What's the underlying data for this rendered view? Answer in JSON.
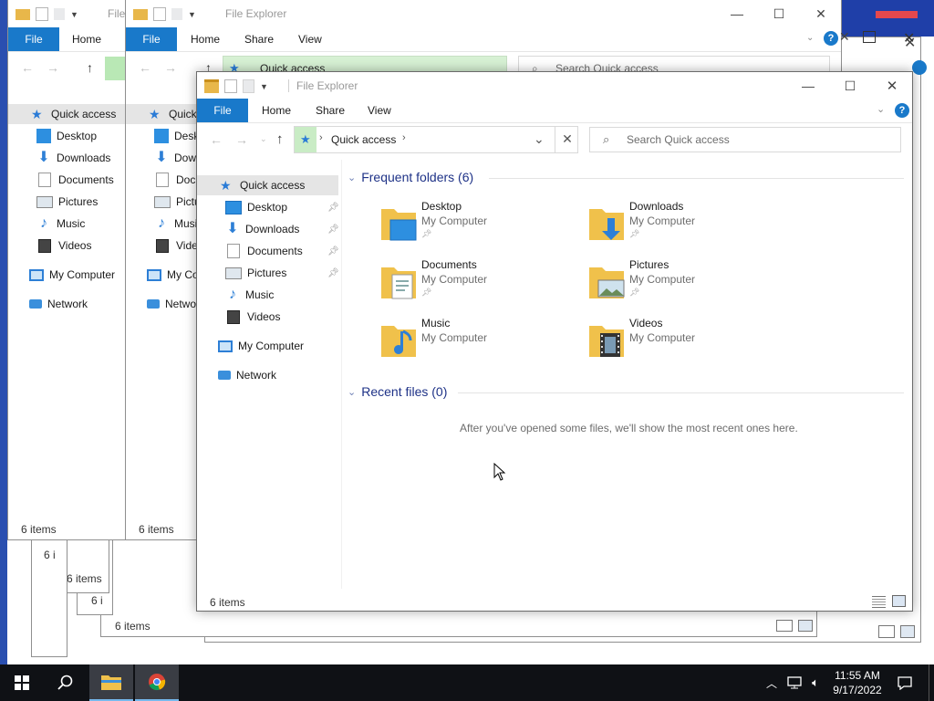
{
  "desktop": {
    "accent_color": "#1979ca",
    "bg_fragment_colors": [
      "#1f3fa8",
      "#e5484d"
    ]
  },
  "back_window_1": {
    "title": "File",
    "tabs": [
      "File",
      "Home"
    ],
    "nav_items": [
      "Quick access",
      "Desktop",
      "Downloads",
      "Documents",
      "Pictures",
      "Music",
      "Videos",
      "My Computer",
      "Network"
    ],
    "status": "6 items"
  },
  "back_window_2": {
    "title": "File Explorer",
    "tabs": [
      "File",
      "Home",
      "Share",
      "View"
    ],
    "address": "Quick access",
    "search_placeholder": "Search Quick access",
    "nav_items": [
      "Quick",
      "Desk",
      "Dow",
      "Docu",
      "Pictu",
      "Musi",
      "Vide",
      "My Co",
      "Netwo"
    ],
    "status": "6 items"
  },
  "stacked_windows": {
    "status_items": [
      "6 i",
      "6 items",
      "6 i",
      "6 items"
    ]
  },
  "main_window": {
    "title": "File Explorer",
    "tabs": {
      "file": "File",
      "home": "Home",
      "share": "Share",
      "view": "View"
    },
    "address": "Quick access",
    "search_placeholder": "Search Quick access",
    "nav": {
      "quick_access": "Quick access",
      "desktop": "Desktop",
      "downloads": "Downloads",
      "documents": "Documents",
      "pictures": "Pictures",
      "music": "Music",
      "videos": "Videos",
      "my_computer": "My Computer",
      "network": "Network"
    },
    "frequent_header": "Frequent folders (6)",
    "folders": [
      {
        "name": "Desktop",
        "location": "My Computer",
        "pinned": true,
        "icon": "desktop-folder-icon"
      },
      {
        "name": "Downloads",
        "location": "My Computer",
        "pinned": true,
        "icon": "downloads-folder-icon"
      },
      {
        "name": "Documents",
        "location": "My Computer",
        "pinned": true,
        "icon": "documents-folder-icon"
      },
      {
        "name": "Pictures",
        "location": "My Computer",
        "pinned": true,
        "icon": "pictures-folder-icon"
      },
      {
        "name": "Music",
        "location": "My Computer",
        "pinned": false,
        "icon": "music-folder-icon"
      },
      {
        "name": "Videos",
        "location": "My Computer",
        "pinned": false,
        "icon": "videos-folder-icon"
      }
    ],
    "recent_header": "Recent files (0)",
    "recent_empty": "After you've opened some files, we'll show the most recent ones here.",
    "status": "6 items"
  },
  "taskbar": {
    "time": "11:55 AM",
    "date": "9/17/2022",
    "apps": [
      "file-explorer",
      "chrome"
    ]
  }
}
